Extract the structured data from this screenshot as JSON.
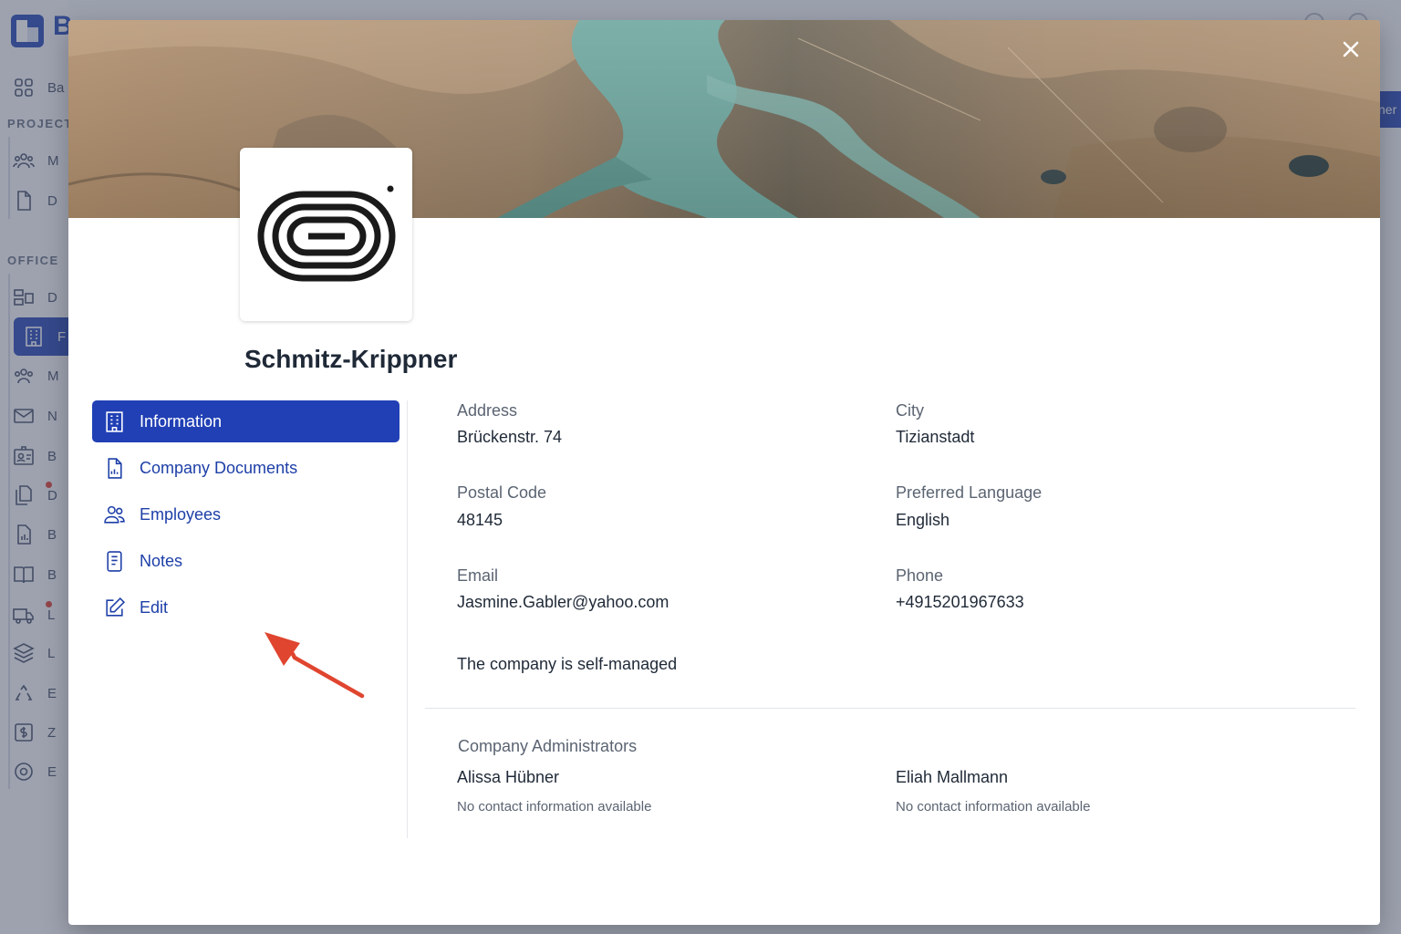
{
  "background_app": {
    "logo_letter": "B",
    "items": [
      {
        "label": "Ba",
        "icon": "grid-icon"
      },
      {
        "label": "M",
        "icon": "users-icon"
      },
      {
        "label": "D",
        "icon": "file-icon"
      },
      {
        "label": "D",
        "icon": "layout-icon"
      },
      {
        "label": "F",
        "icon": "building-icon"
      },
      {
        "label": "M",
        "icon": "users-icon"
      },
      {
        "label": "N",
        "icon": "mail-icon"
      },
      {
        "label": "B",
        "icon": "id-card-icon"
      },
      {
        "label": "D",
        "icon": "documents-icon"
      },
      {
        "label": "B",
        "icon": "report-icon"
      },
      {
        "label": "B",
        "icon": "book-icon"
      },
      {
        "label": "L",
        "icon": "truck-icon"
      },
      {
        "label": "L",
        "icon": "layers-icon"
      },
      {
        "label": "E",
        "icon": "recycle-icon"
      },
      {
        "label": "Z",
        "icon": "dollar-icon"
      },
      {
        "label": "E",
        "icon": "settings-icon"
      }
    ],
    "sections": {
      "project": "PROJECT",
      "office": "OFFICE"
    },
    "right_button_label": "ner"
  },
  "modal": {
    "company_name": "Schmitz-Krippner",
    "nav": [
      {
        "label": "Information",
        "icon": "building-icon",
        "active": true
      },
      {
        "label": "Company Documents",
        "icon": "document-icon",
        "active": false
      },
      {
        "label": "Employees",
        "icon": "users-icon",
        "active": false
      },
      {
        "label": "Notes",
        "icon": "notes-icon",
        "active": false
      },
      {
        "label": "Edit",
        "icon": "edit-icon",
        "active": false
      }
    ],
    "fields": {
      "address": {
        "label": "Address",
        "value": "Brückenstr. 74"
      },
      "city": {
        "label": "City",
        "value": "Tizianstadt"
      },
      "postal_code": {
        "label": "Postal Code",
        "value": "48145"
      },
      "preferred_language": {
        "label": "Preferred Language",
        "value": "English"
      },
      "email": {
        "label": "Email",
        "value": "Jasmine.Gabler@yahoo.com"
      },
      "phone": {
        "label": "Phone",
        "value": "+4915201967633"
      }
    },
    "self_managed_text": "The company is self-managed",
    "administrators": {
      "heading": "Company Administrators",
      "people": [
        {
          "name": "Alissa Hübner",
          "contact": "No contact information available"
        },
        {
          "name": "Eliah Mallmann",
          "contact": "No contact information available"
        }
      ]
    }
  },
  "colors": {
    "primary": "#2140b5",
    "annotation_arrow": "#e0452f"
  }
}
